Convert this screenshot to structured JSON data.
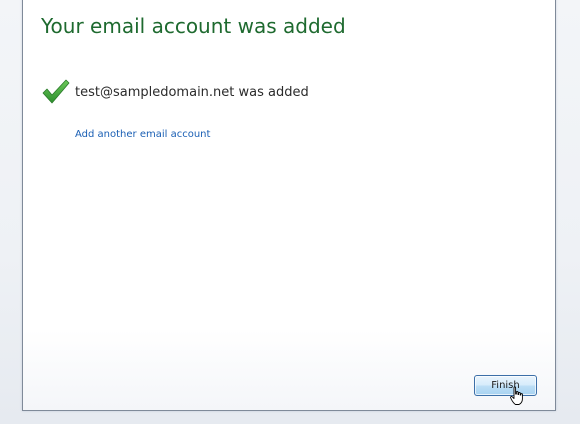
{
  "wizard": {
    "title": "Your email account was added",
    "status_message": "test@sampledomain.net was added",
    "add_another_link": "Add another email account",
    "finish_label": "Finish"
  },
  "icons": {
    "success": "checkmark-icon",
    "pointer": "hand-cursor-icon"
  },
  "colors": {
    "title": "#1e6a2f",
    "check": "#3aa33a",
    "link": "#1a5fb4",
    "button_border": "#3c6fa8"
  }
}
